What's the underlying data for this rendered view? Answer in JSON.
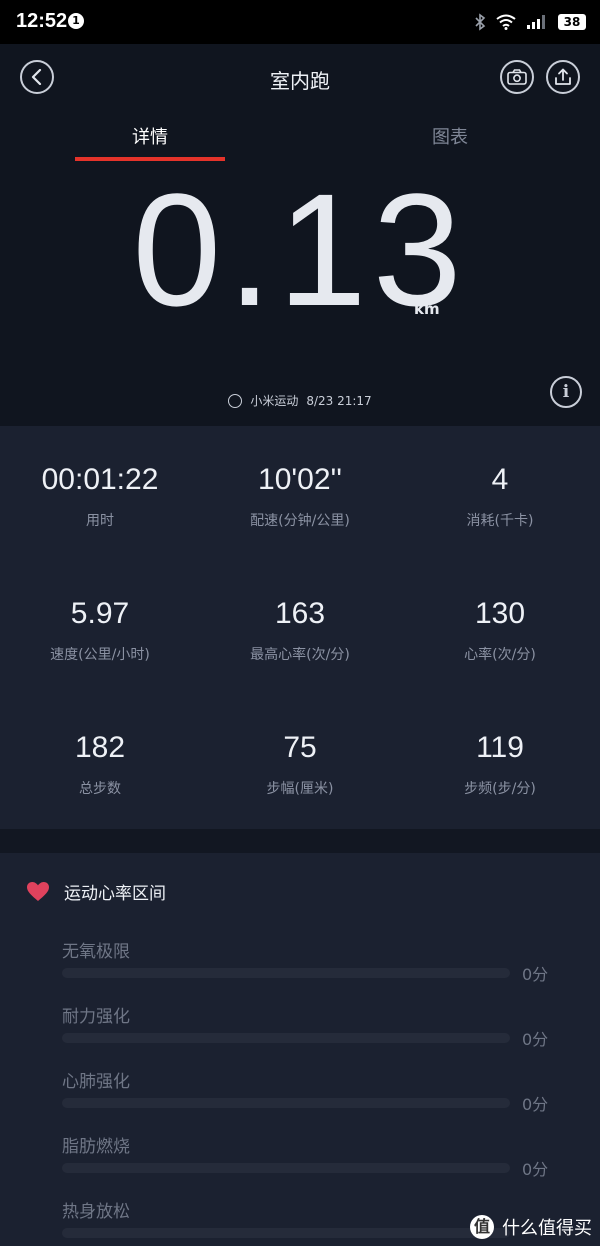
{
  "status_bar": {
    "time": "12:52",
    "notification_count": "1",
    "battery": "38"
  },
  "header": {
    "title": "室内跑"
  },
  "tabs": [
    {
      "label": "详情",
      "active": true
    },
    {
      "label": "图表",
      "active": false
    }
  ],
  "hero": {
    "distance": "0.13",
    "unit": "km",
    "source": "小米运动",
    "datetime": "8/23 21:17"
  },
  "stats": [
    {
      "value": "00:01:22",
      "label": "用时"
    },
    {
      "value": "10'02''",
      "label": "配速(分钟/公里)"
    },
    {
      "value": "4",
      "label": "消耗(千卡)"
    },
    {
      "value": "5.97",
      "label": "速度(公里/小时)"
    },
    {
      "value": "163",
      "label": "最高心率(次/分)"
    },
    {
      "value": "130",
      "label": "心率(次/分)"
    },
    {
      "value": "182",
      "label": "总步数"
    },
    {
      "value": "75",
      "label": "步幅(厘米)"
    },
    {
      "value": "119",
      "label": "步频(步/分)"
    }
  ],
  "heart_rate_zones": {
    "title": "运动心率区间",
    "zones": [
      {
        "label": "无氧极限",
        "time": "0分",
        "fraction": 0
      },
      {
        "label": "耐力强化",
        "time": "0分",
        "fraction": 0
      },
      {
        "label": "心肺强化",
        "time": "0分",
        "fraction": 0
      },
      {
        "label": "脂肪燃烧",
        "time": "0分",
        "fraction": 0
      },
      {
        "label": "热身放松",
        "time": "",
        "fraction": 0
      }
    ]
  },
  "watermark": {
    "logo_char": "值",
    "text": "什么值得买"
  },
  "colors": {
    "accent": "#e5332a",
    "heart": "#e0425d"
  }
}
